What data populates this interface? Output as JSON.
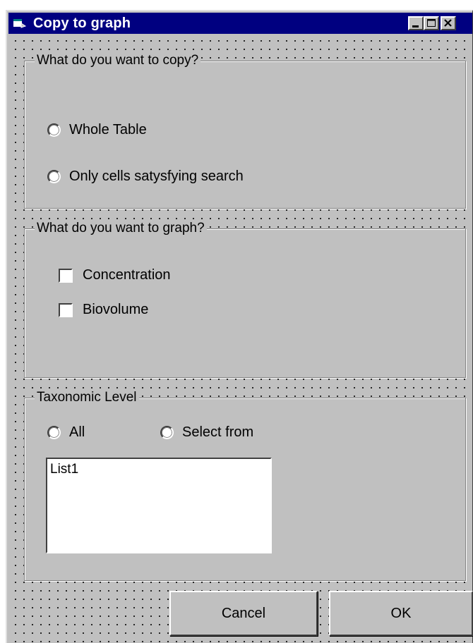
{
  "window": {
    "title": "Copy to graph",
    "app_icon": "form-icon",
    "controls": [
      "minimize-icon",
      "maximize-icon",
      "close-icon"
    ]
  },
  "copy_frame": {
    "legend": "What do you want to copy?",
    "options": [
      "Whole Table",
      "Only cells satysfying search"
    ]
  },
  "graph_frame": {
    "legend": "What do you want to graph?",
    "checkboxes": [
      "Concentration",
      "Biovolume"
    ]
  },
  "taxonomic_frame": {
    "legend": "Taxonomic Level",
    "options": [
      "All",
      "Select from"
    ],
    "list": {
      "items": [
        "List1"
      ]
    }
  },
  "buttons": {
    "cancel": "Cancel",
    "ok": "OK"
  },
  "colors": {
    "titlebar": "#000080",
    "face": "#c0c0c0"
  }
}
